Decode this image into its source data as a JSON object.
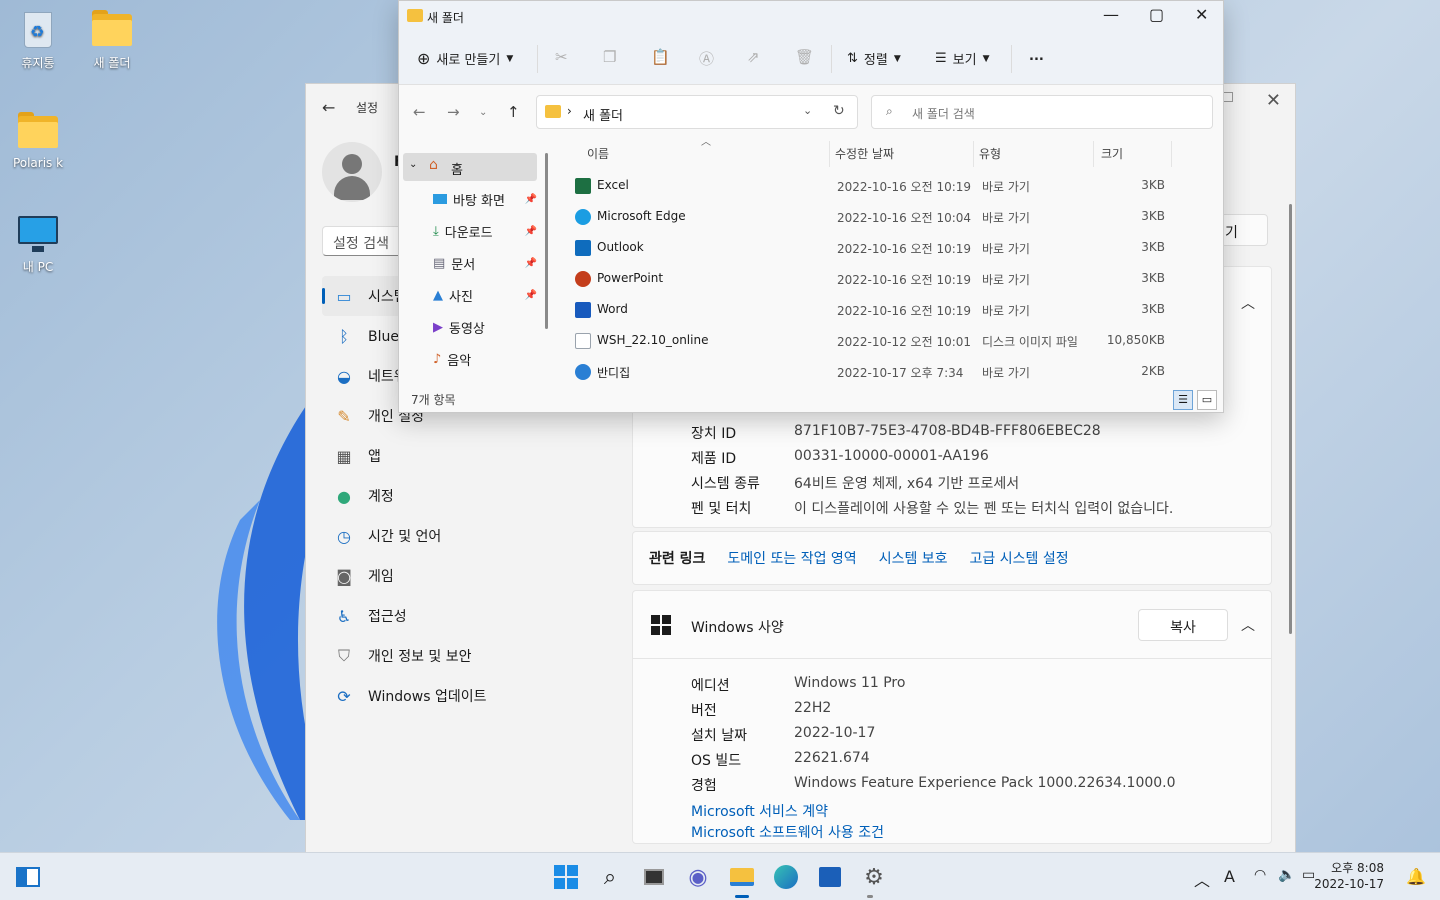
{
  "desktop": {
    "icons": [
      {
        "label": "휴지통"
      },
      {
        "label": "새 폴더"
      },
      {
        "label": "Polaris k"
      },
      {
        "label": "내 PC"
      }
    ]
  },
  "settings": {
    "title": "설정",
    "user_initial": "F",
    "search_placeholder": "설정 검색",
    "nav": [
      {
        "label": "시스템",
        "icon": "monitor-icon"
      },
      {
        "label": "Bluetooth 및 장치",
        "icon": "bluetooth-icon"
      },
      {
        "label": "네트워크 및 인터넷",
        "icon": "wifi-icon"
      },
      {
        "label": "개인 설정",
        "icon": "brush-icon"
      },
      {
        "label": "앱",
        "icon": "apps-icon"
      },
      {
        "label": "계정",
        "icon": "account-icon"
      },
      {
        "label": "시간 및 언어",
        "icon": "globe-clock-icon"
      },
      {
        "label": "게임",
        "icon": "gamepad-icon"
      },
      {
        "label": "접근성",
        "icon": "accessibility-icon"
      },
      {
        "label": "개인 정보 및 보안",
        "icon": "shield-icon"
      },
      {
        "label": "Windows 업데이트",
        "icon": "update-icon"
      }
    ],
    "rename_label": "기",
    "device_specs": [
      {
        "k": "장치 ID",
        "v": "871F10B7-75E3-4708-BD4B-FFF806EBEC28"
      },
      {
        "k": "제품 ID",
        "v": "00331-10000-00001-AA196"
      },
      {
        "k": "시스템 종류",
        "v": "64비트 운영 체제, x64 기반 프로세서"
      },
      {
        "k": "펜 및 터치",
        "v": "이 디스플레이에 사용할 수 있는 펜 또는 터치식 입력이 없습니다."
      }
    ],
    "related_links": {
      "label": "관련 링크",
      "links": [
        "도메인 또는 작업 영역",
        "시스템 보호",
        "고급 시스템 설정"
      ]
    },
    "windows_spec": {
      "title": "Windows 사양",
      "copy_label": "복사",
      "rows": [
        {
          "k": "에디션",
          "v": "Windows 11 Pro"
        },
        {
          "k": "버전",
          "v": "22H2"
        },
        {
          "k": "설치 날짜",
          "v": "2022-10-17"
        },
        {
          "k": "OS 빌드",
          "v": "22621.674"
        },
        {
          "k": "경험",
          "v": "Windows Feature Experience Pack 1000.22634.1000.0"
        }
      ],
      "links": [
        "Microsoft 서비스 계약",
        "Microsoft 소프트웨어 사용 조건"
      ]
    }
  },
  "explorer": {
    "title": "새 폴더",
    "cmd": {
      "new": "새로 만들기",
      "sort": "정렬",
      "view": "보기",
      "more": "..."
    },
    "address": "새 폴더",
    "search_placeholder": "새 폴더 검색",
    "sidebar": {
      "home": "홈",
      "items": [
        {
          "label": "바탕 화면",
          "icon": "desktop-icon",
          "pinned": true
        },
        {
          "label": "다운로드",
          "icon": "download-icon",
          "pinned": true
        },
        {
          "label": "문서",
          "icon": "document-icon",
          "pinned": true
        },
        {
          "label": "사진",
          "icon": "pictures-icon",
          "pinned": true
        },
        {
          "label": "동영상",
          "icon": "videos-icon",
          "pinned": false
        },
        {
          "label": "음악",
          "icon": "music-icon",
          "pinned": false
        }
      ]
    },
    "columns": {
      "name": "이름",
      "date": "수정한 날짜",
      "type": "유형",
      "size": "크기"
    },
    "files": [
      {
        "name": "Excel",
        "date": "2022-10-16 오전 10:19",
        "type": "바로 가기",
        "size": "3KB",
        "color": "#1d6f42"
      },
      {
        "name": "Microsoft Edge",
        "date": "2022-10-16 오전 10:04",
        "type": "바로 가기",
        "size": "3KB",
        "color": "#1b9de2"
      },
      {
        "name": "Outlook",
        "date": "2022-10-16 오전 10:19",
        "type": "바로 가기",
        "size": "3KB",
        "color": "#0f6cbd"
      },
      {
        "name": "PowerPoint",
        "date": "2022-10-16 오전 10:19",
        "type": "바로 가기",
        "size": "3KB",
        "color": "#c43e1c"
      },
      {
        "name": "Word",
        "date": "2022-10-16 오전 10:19",
        "type": "바로 가기",
        "size": "3KB",
        "color": "#185abd"
      },
      {
        "name": "WSH_22.10_online",
        "date": "2022-10-12 오전 10:01",
        "type": "디스크 이미지 파일",
        "size": "10,850KB",
        "color": "#9aa3ad"
      },
      {
        "name": "반디집",
        "date": "2022-10-17 오후 7:34",
        "type": "바로 가기",
        "size": "2KB",
        "color": "#2a7fd4"
      }
    ],
    "status": "7개 항목"
  },
  "taskbar": {
    "time": "오후 8:08",
    "date": "2022-10-17",
    "ime": "A"
  }
}
